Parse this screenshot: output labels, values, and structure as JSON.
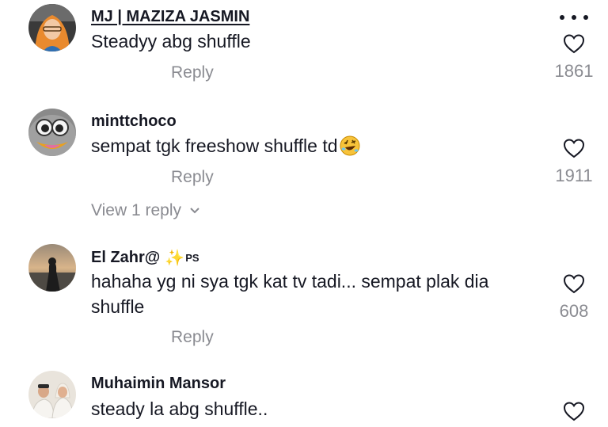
{
  "comments": [
    {
      "username": "MJ | MAZIZA JASMIN",
      "text": "Steadyy abg shuffle",
      "reply_label": "Reply",
      "like_count": "1861",
      "avatar": "avatar-woman-hijab-orange"
    },
    {
      "username": "minttchoco",
      "text": "sempat tgk freeshow shuffle td",
      "emoji": "rolling-on-floor-laughing-emoji",
      "reply_label": "Reply",
      "like_count": "1911",
      "view_replies_label": "View 1 reply",
      "avatar": "avatar-cartoon-face"
    },
    {
      "username": "El Zahr@",
      "badge_label": "PS",
      "text": "hahaha yg ni sya tgk kat tv tadi... sempat plak dia shuffle",
      "reply_label": "Reply",
      "like_count": "608",
      "avatar": "avatar-beach-sunset"
    },
    {
      "username": "Muhaimin Mansor",
      "text": "steady la abg shuffle..",
      "avatar": "avatar-couple-white"
    }
  ],
  "icons": {
    "like": "heart-outline-icon",
    "more": "more-horizontal-icon",
    "expand": "chevron-down-icon"
  },
  "colors": {
    "text_primary": "#161823",
    "text_secondary": "#8a8b91"
  }
}
